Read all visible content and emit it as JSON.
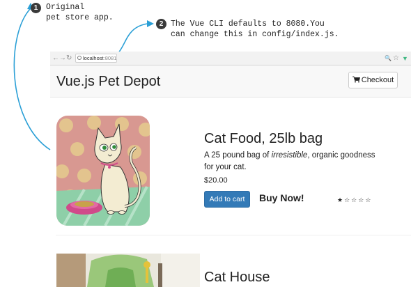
{
  "annotations": [
    {
      "number": "1",
      "text": "Original\npet store app."
    },
    {
      "number": "2",
      "text": "The Vue CLI defaults to 8080.You\ncan change this in config/index.js."
    }
  ],
  "browser": {
    "back": "←",
    "forward": "→",
    "reload": "↻",
    "url_host": "localhost",
    "url_port": ":8081",
    "zoom_icon": "🔍",
    "star_icon": "☆",
    "vue_icon": "▼"
  },
  "header": {
    "brand": "Vue.js Pet Depot",
    "checkout_label": "Checkout",
    "cart_icon": "cart-icon"
  },
  "products": [
    {
      "title": "Cat Food, 25lb bag",
      "description_before": "A 25 pound bag of ",
      "description_em": "irresistible",
      "description_after": ", organic goodness for your cat.",
      "price": "$20.00",
      "add_label": "Add to cart",
      "buy_label": "Buy Now!",
      "rating": 1,
      "rating_max": 5
    },
    {
      "title": "Cat House"
    }
  ],
  "colors": {
    "primary_button": "#337ab7",
    "callout_line": "#2a9fd6"
  }
}
